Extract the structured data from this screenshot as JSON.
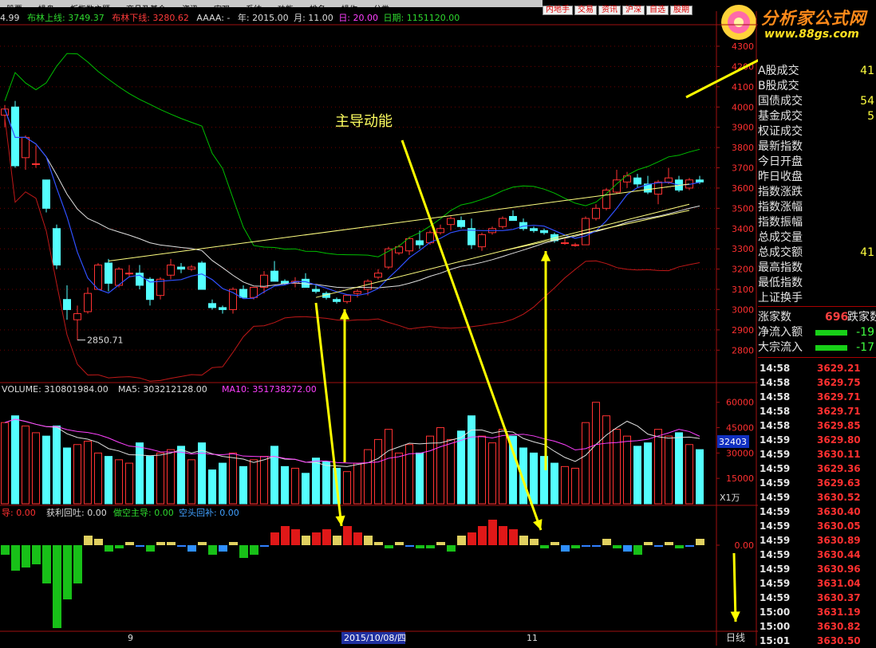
{
  "menu": [
    "股票",
    "操盘",
    "板指数主题",
    "商品及基金",
    "资讯",
    "宏观",
    "系统",
    "功能",
    "排名",
    "操作",
    "分类"
  ],
  "tabs": [
    "内地手",
    "交易",
    "资讯",
    "沪深",
    "自选",
    "股期"
  ],
  "info": {
    "prefix": "4.99",
    "upper": "布林上线: 3749.37",
    "lower": "布林下线: 3280.62",
    "aaaa": "AAAA: -",
    "year": "年: 2015.00",
    "month": "月: 11.00",
    "day": "日: 20.00",
    "date": "日期: 1151120.00"
  },
  "logo": {
    "title": "分析家公式网",
    "url": "www.88gs.com"
  },
  "price_axis": [
    "4300",
    "4200",
    "4100",
    "4000",
    "3900",
    "3800",
    "3700",
    "3600",
    "3500",
    "3400",
    "3300",
    "3200",
    "3100",
    "3000",
    "2900",
    "2800"
  ],
  "low_mark": "2850.71",
  "annotation": "主导动能",
  "volume_legend": {
    "v": "VOLUME: 310801984.00",
    "ma5": "MA5: 303212128.00",
    "ma10": "MA10: 351738272.00"
  },
  "volume_axis": [
    "60000",
    "45000",
    "30000",
    "15000"
  ],
  "volume_current": "32403",
  "volume_unit": "X1万",
  "ind_legend": {
    "a": "导: 0.00",
    "b": "获利回吐: 0.00",
    "c": "做空主导: 0.00",
    "d": "空头回补: 0.00"
  },
  "ind_axis": "0.00",
  "x_labels": [
    "9",
    "2015/10/08/四",
    "11"
  ],
  "period": "日线",
  "quote": [
    {
      "label": "A股成交",
      "value": "41"
    },
    {
      "label": "B股成交",
      "value": ""
    },
    {
      "label": "国债成交",
      "value": "54"
    },
    {
      "label": "基金成交",
      "value": "5"
    },
    {
      "label": "权证成交",
      "value": ""
    },
    {
      "label": "最新指数",
      "value": ""
    },
    {
      "label": "今日开盘",
      "value": ""
    },
    {
      "label": "昨日收盘",
      "value": ""
    },
    {
      "label": "指数涨跌",
      "value": ""
    },
    {
      "label": "指数涨幅",
      "value": ""
    },
    {
      "label": "指数振幅",
      "value": ""
    },
    {
      "label": "总成交量",
      "value": ""
    },
    {
      "label": "总成交额",
      "value": "41"
    },
    {
      "label": "最高指数",
      "value": ""
    },
    {
      "label": "最低指数",
      "value": ""
    },
    {
      "label": "上证换手",
      "value": ""
    }
  ],
  "breadth": {
    "up_label": "涨家数",
    "up_value": "696",
    "down_label": "跌家数"
  },
  "flows": [
    {
      "label": "净流入额",
      "value": "-19"
    },
    {
      "label": "大宗流入",
      "value": "-17"
    }
  ],
  "ticks": [
    {
      "t": "14:58",
      "p": "3629.21"
    },
    {
      "t": "14:58",
      "p": "3629.75"
    },
    {
      "t": "14:58",
      "p": "3629.71"
    },
    {
      "t": "14:58",
      "p": "3629.71"
    },
    {
      "t": "14:58",
      "p": "3629.85"
    },
    {
      "t": "14:59",
      "p": "3629.80"
    },
    {
      "t": "14:59",
      "p": "3630.11"
    },
    {
      "t": "14:59",
      "p": "3629.36"
    },
    {
      "t": "14:59",
      "p": "3629.63"
    },
    {
      "t": "14:59",
      "p": "3630.52"
    },
    {
      "t": "14:59",
      "p": "3630.40"
    },
    {
      "t": "14:59",
      "p": "3630.05"
    },
    {
      "t": "14:59",
      "p": "3630.89"
    },
    {
      "t": "14:59",
      "p": "3630.44"
    },
    {
      "t": "14:59",
      "p": "3630.96"
    },
    {
      "t": "14:59",
      "p": "3631.04"
    },
    {
      "t": "14:59",
      "p": "3630.37"
    },
    {
      "t": "15:00",
      "p": "3631.19"
    },
    {
      "t": "15:00",
      "p": "3630.82"
    },
    {
      "t": "15:01",
      "p": "3630.50"
    }
  ],
  "colors": {
    "up": "#ff3232",
    "down": "#54ffff",
    "boll_up": "#00c000",
    "boll_low": "#c01818",
    "mid": "#e0e0e0",
    "trend": "#ffff80",
    "arrow": "#ffff00",
    "ma10": "#ff40ff"
  },
  "chart_data": {
    "type": "candlestick",
    "dates": [
      "2015/10/08"
    ],
    "ohlc": [
      [
        3960,
        4010,
        3900,
        3990
      ],
      [
        4000,
        4030,
        3700,
        3710
      ],
      [
        3750,
        3860,
        3690,
        3850
      ],
      [
        3720,
        3810,
        3700,
        3720
      ],
      [
        3640,
        3640,
        3480,
        3500
      ],
      [
        3400,
        3420,
        3200,
        3220
      ],
      [
        3050,
        3120,
        2950,
        3000
      ],
      [
        2950,
        3020,
        2850,
        2980
      ],
      [
        2990,
        3110,
        2980,
        3080
      ],
      [
        3100,
        3230,
        3100,
        3220
      ],
      [
        3230,
        3250,
        3090,
        3130
      ],
      [
        3120,
        3210,
        3110,
        3200
      ],
      [
        3180,
        3220,
        3160,
        3180
      ],
      [
        3180,
        3220,
        3100,
        3120
      ],
      [
        3150,
        3160,
        3020,
        3050
      ],
      [
        3070,
        3160,
        3050,
        3150
      ],
      [
        3170,
        3250,
        3150,
        3220
      ],
      [
        3210,
        3230,
        3180,
        3200
      ],
      [
        3200,
        3220,
        3190,
        3210
      ],
      [
        3230,
        3240,
        3100,
        3100
      ],
      [
        3030,
        3050,
        3000,
        3010
      ],
      [
        3010,
        3020,
        2980,
        3000
      ],
      [
        3000,
        3110,
        2980,
        3100
      ],
      [
        3100,
        3120,
        3060,
        3060
      ],
      [
        3060,
        3110,
        3050,
        3110
      ],
      [
        3110,
        3190,
        3080,
        3170
      ],
      [
        3190,
        3240,
        3140,
        3140
      ],
      [
        3140,
        3150,
        3120,
        3130
      ],
      [
        3130,
        3160,
        3110,
        3140
      ],
      [
        3150,
        3180,
        3110,
        3110
      ],
      [
        3100,
        3120,
        3080,
        3090
      ],
      [
        3080,
        3090,
        3050,
        3060
      ],
      [
        3050,
        3060,
        3030,
        3040
      ],
      [
        3040,
        3070,
        3030,
        3070
      ],
      [
        3080,
        3100,
        3060,
        3090
      ],
      [
        3100,
        3150,
        3070,
        3140
      ],
      [
        3160,
        3200,
        3150,
        3180
      ],
      [
        3210,
        3310,
        3200,
        3300
      ],
      [
        3280,
        3320,
        3270,
        3310
      ],
      [
        3290,
        3360,
        3270,
        3350
      ],
      [
        3340,
        3390,
        3300,
        3320
      ],
      [
        3330,
        3390,
        3320,
        3380
      ],
      [
        3380,
        3420,
        3370,
        3400
      ],
      [
        3420,
        3460,
        3390,
        3450
      ],
      [
        3440,
        3460,
        3400,
        3410
      ],
      [
        3400,
        3450,
        3300,
        3320
      ],
      [
        3310,
        3380,
        3290,
        3370
      ],
      [
        3380,
        3410,
        3370,
        3400
      ],
      [
        3410,
        3460,
        3400,
        3450
      ],
      [
        3460,
        3490,
        3440,
        3440
      ],
      [
        3430,
        3450,
        3390,
        3400
      ],
      [
        3400,
        3410,
        3380,
        3390
      ],
      [
        3390,
        3400,
        3370,
        3380
      ],
      [
        3370,
        3380,
        3330,
        3340
      ],
      [
        3330,
        3350,
        3320,
        3330
      ],
      [
        3320,
        3330,
        3310,
        3320
      ],
      [
        3320,
        3460,
        3320,
        3450
      ],
      [
        3450,
        3520,
        3440,
        3500
      ],
      [
        3500,
        3600,
        3490,
        3590
      ],
      [
        3580,
        3690,
        3570,
        3640
      ],
      [
        3630,
        3680,
        3600,
        3660
      ],
      [
        3650,
        3670,
        3600,
        3620
      ],
      [
        3620,
        3660,
        3570,
        3580
      ],
      [
        3570,
        3640,
        3520,
        3630
      ],
      [
        3630,
        3700,
        3620,
        3650
      ],
      [
        3640,
        3660,
        3580,
        3590
      ],
      [
        3600,
        3650,
        3590,
        3640
      ],
      [
        3640,
        3660,
        3620,
        3630
      ]
    ],
    "volume": [
      48000,
      52000,
      46000,
      42000,
      40000,
      46000,
      33000,
      35000,
      37000,
      30000,
      28000,
      26000,
      24000,
      36000,
      28000,
      30000,
      32000,
      34000,
      26000,
      36000,
      20000,
      24000,
      30000,
      22000,
      26000,
      28000,
      34000,
      22000,
      21000,
      18000,
      27000,
      25000,
      21000,
      19000,
      24000,
      32000,
      38000,
      44000,
      30000,
      35000,
      30000,
      40000,
      45000,
      38000,
      43000,
      52000,
      40000,
      36000,
      44000,
      40000,
      33000,
      30000,
      28000,
      24000,
      22000,
      21000,
      48000,
      60000,
      52000,
      44000,
      40000,
      34000,
      36000,
      44000,
      40000,
      42000,
      35000,
      32000
    ],
    "indicator": [
      -3,
      -8,
      -7,
      -6,
      -12,
      -26,
      -17,
      -12,
      3,
      2,
      -2,
      -1,
      1,
      0,
      -2,
      1,
      1,
      0,
      -2,
      1,
      -3,
      -2,
      1,
      -4,
      -3,
      0,
      4,
      6,
      5,
      3,
      4,
      5,
      3,
      6,
      4,
      3,
      1,
      -1,
      1,
      0,
      -1,
      -1,
      1,
      -2,
      3,
      4,
      6,
      8,
      6,
      5,
      3,
      2,
      -1,
      1,
      -2,
      -1,
      0,
      0,
      2,
      -1,
      -2,
      -3,
      1,
      0,
      1,
      -1,
      0,
      2
    ],
    "ylim": [
      2750,
      4300
    ]
  }
}
